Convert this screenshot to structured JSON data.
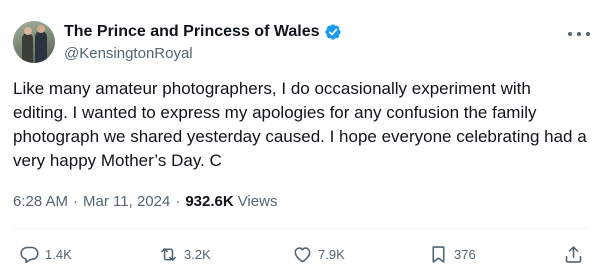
{
  "user": {
    "display_name": "The Prince and Princess of Wales",
    "handle": "@KensingtonRoyal",
    "verified": true
  },
  "tweet": {
    "text": "Like many amateur photographers, I do occasionally experiment with editing. I wanted to express my apologies for any confusion the family photograph we shared yesterday caused. I hope everyone celebrating had a very happy Mother’s Day. C",
    "time": "6:28 AM",
    "separator": "·",
    "date": "Mar 11, 2024",
    "views_count": "932.6K",
    "views_label": "Views"
  },
  "actions": {
    "replies": "1.4K",
    "reposts": "3.2K",
    "likes": "7.9K",
    "bookmarks": "376"
  },
  "icons": {
    "verified": "verified-badge-icon",
    "more": "more-options-icon",
    "reply": "reply-icon",
    "repost": "repost-icon",
    "like": "heart-icon",
    "bookmark": "bookmark-icon",
    "share": "share-icon"
  },
  "colors": {
    "accent": "#1d9bf0",
    "text": "#0f1419",
    "muted": "#536471",
    "divider": "#eff3f4"
  }
}
